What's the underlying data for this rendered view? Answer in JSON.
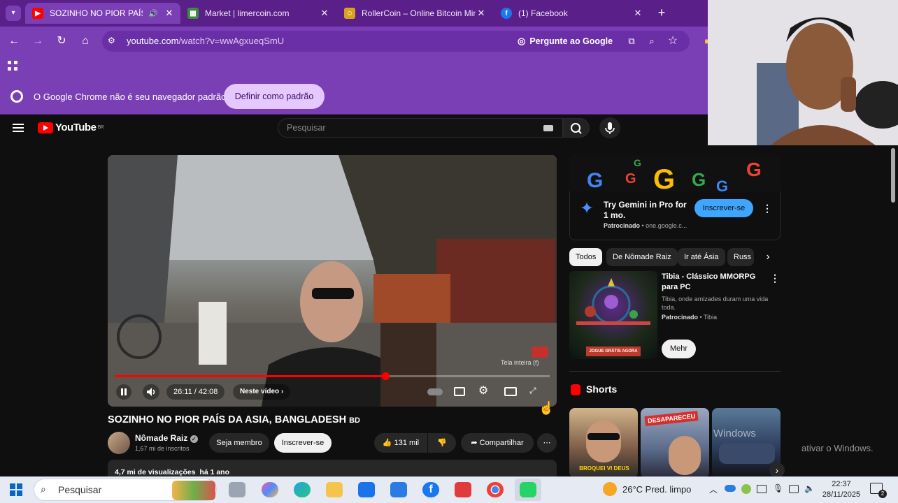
{
  "browser": {
    "tabs": [
      {
        "title": "SOZINHO NO PIOR PAÍS DA",
        "favicon": "youtube-icon",
        "active": true
      },
      {
        "title": "Market | limercoin.com",
        "favicon": "limercoin-icon",
        "active": false
      },
      {
        "title": "RollerCoin – Online Bitcoin Min",
        "favicon": "rollercoin-icon",
        "active": false
      },
      {
        "title": "(1) Facebook",
        "favicon": "facebook-icon",
        "active": false
      }
    ],
    "url_host": "youtube.com",
    "url_path": "/watch?v=wwAgxueqSmU",
    "ask_google": "Pergunte ao Google",
    "infobar_text": "O Google Chrome não é seu navegador padrão",
    "infobar_button": "Definir como padrão",
    "accent": "#7a3fb4"
  },
  "youtube": {
    "logo": "YouTube",
    "country": "BR",
    "search_placeholder": "Pesquisar",
    "player": {
      "time": "26:11 / 42:08",
      "progress": 0.6215,
      "next_label": "Neste vídeo",
      "overlay_label": "Tela inteira",
      "overlay_key": "f"
    },
    "video": {
      "title": "SOZINHO NO PIOR PAÍS DA ASIA, BANGLADESH",
      "flag": "BD",
      "channel": "Nômade Raiz",
      "subscribers": "1,67 mi de inscritos",
      "join": "Seja membro",
      "subscribe": "Inscrever-se",
      "likes": "131 mil",
      "share": "Compartilhar",
      "views": "4,7 mi de visualizações",
      "age": "há 1 ano"
    },
    "ad": {
      "title": "Try Gemini in Pro for 1 mo.",
      "sponsored": "Patrocinado",
      "domain": "one.google.c...",
      "button": "Inscrever-se"
    },
    "chips": [
      "Todos",
      "De Nômade Raiz",
      "Ir até Ásia",
      "Russ"
    ],
    "tibia": {
      "title": "Tibia - Clássico MMORPG para PC",
      "desc": "Tibia, onde amizades duram uma vida toda.",
      "sponsored": "Patrocinado",
      "advertiser": "Tibia",
      "button": "Mehr",
      "thumb_cta": "JOGUE GRÁTIS AGORA"
    },
    "shorts": {
      "title": "Shorts",
      "items": [
        {
          "caption": "BROQUEI VI DEUS"
        },
        {
          "caption": "DESAPARECEU"
        },
        {
          "caption": ""
        }
      ]
    }
  },
  "windows": {
    "watermark_line1": "Windows",
    "watermark_line2": "ativar o Windows.",
    "search_placeholder": "Pesquisar",
    "weather": "26°C Pred. limpo",
    "time": "22:37",
    "date": "28/11/2025",
    "notification_count": "2"
  }
}
